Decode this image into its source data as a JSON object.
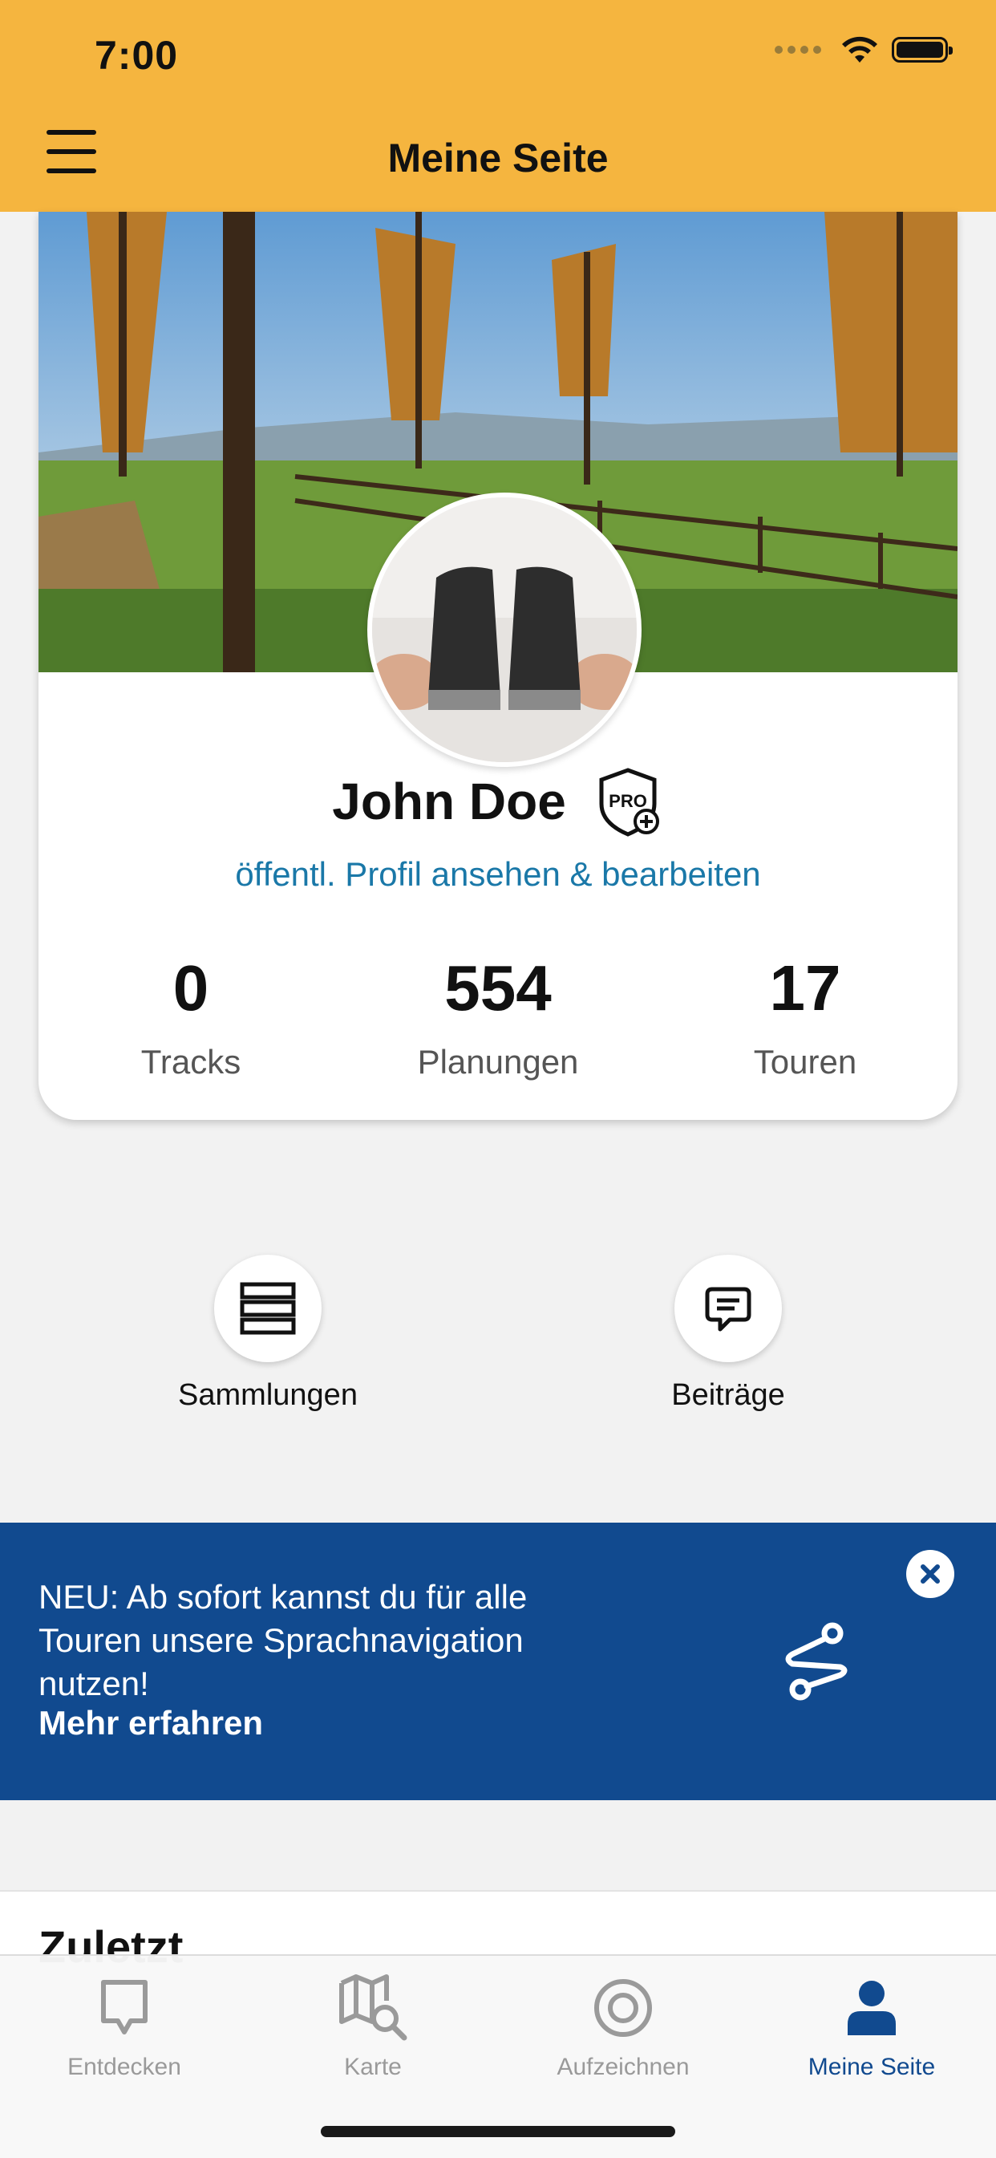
{
  "status_bar": {
    "time": "7:00"
  },
  "header": {
    "title": "Meine Seite"
  },
  "profile": {
    "name": "John Doe",
    "public_profile_link": "öffentl. Profil ansehen & bearbeiten",
    "stats": [
      {
        "value": "0",
        "label": "Tracks"
      },
      {
        "value": "554",
        "label": "Planungen"
      },
      {
        "value": "17",
        "label": "Touren"
      }
    ]
  },
  "quick_actions": [
    {
      "label": "Sammlungen",
      "icon": "collection-icon"
    },
    {
      "label": "Beiträge",
      "icon": "chat-bubble-icon"
    }
  ],
  "banner": {
    "text": "NEU: Ab sofort kannst du für alle Touren unsere Sprachnavigation nutzen!",
    "link": "Mehr erfahren"
  },
  "recent": {
    "title": "Zuletzt"
  },
  "tabbar": {
    "items": [
      {
        "label": "Entdecken",
        "icon": "discover-icon"
      },
      {
        "label": "Karte",
        "icon": "map-search-icon"
      },
      {
        "label": "Aufzeichnen",
        "icon": "record-icon"
      },
      {
        "label": "Meine Seite",
        "icon": "user-icon",
        "active": true
      }
    ]
  },
  "colors": {
    "header": "#f5b53f",
    "banner": "#114a8f",
    "link": "#1a78a8",
    "active_tab": "#114a8f"
  }
}
